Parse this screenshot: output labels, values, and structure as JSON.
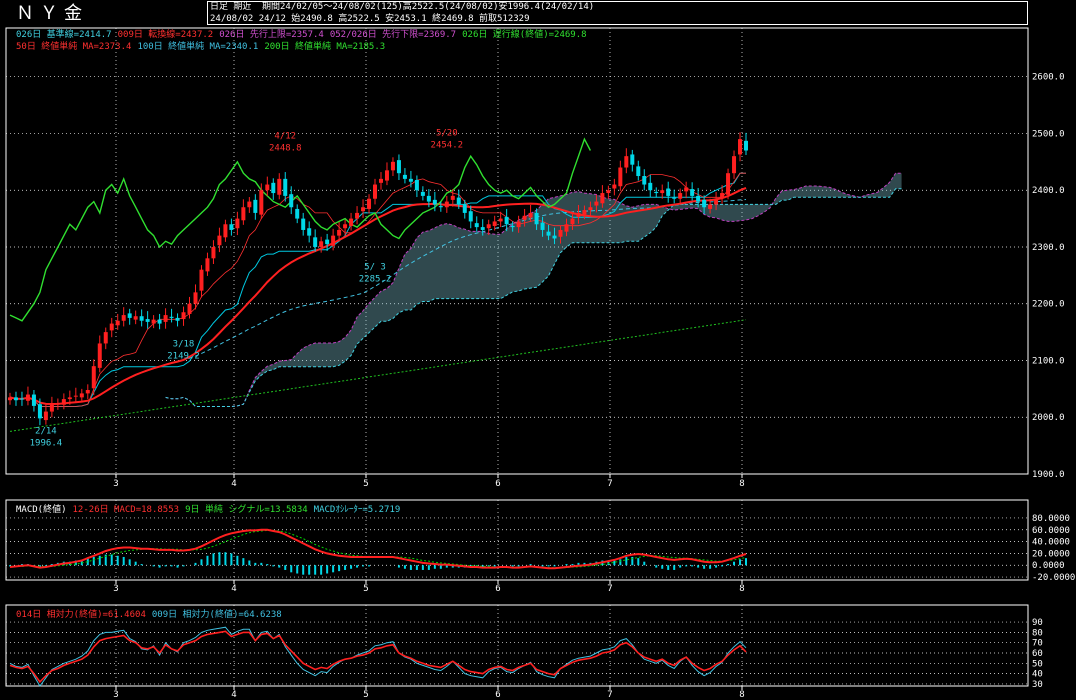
{
  "header": {
    "title": "ＮＹ金",
    "period_label": "日足 期近",
    "summary": "期間24/02/05～24/08/02(125)高2522.5(24/08/02)安1996.4(24/02/14)",
    "ohlc": "24/08/02 24/12 始2490.8 高2522.5 安2453.1 終2469.8 前取512329"
  },
  "colors": {
    "bg": "#000000",
    "frame": "#ffffff",
    "grid": "#ffffff",
    "candle_up": "#ff2020",
    "candle_down": "#00d8e8",
    "kijun": "#00c8e0",
    "tenkan": "#ff3030",
    "senkou_a": "#c040c0",
    "senkou_b": "#40d0e0",
    "chikou": "#30e030",
    "ma50": "#ff2020",
    "ma100": "#40c0e0",
    "ma200": "#20c020",
    "cloud": "#8ad0e0",
    "macd": "#ff2020",
    "signal": "#00d000",
    "osc": "#00d8e8",
    "rsi14": "#ff2020",
    "rsi9": "#40c0e0"
  },
  "legends": {
    "main_row1": [
      {
        "text": "026日 基準線=2414.7",
        "color": "#40d0e0"
      },
      {
        "text": "009日 転換線=2437.2",
        "color": "#ff3030"
      },
      {
        "text": "026日 先行上限=2357.4",
        "color": "#d050d0"
      },
      {
        "text": "052/026日 先行下限=2369.7",
        "color": "#d050d0"
      },
      {
        "text": "026日 遅行線(終値)=2469.8",
        "color": "#30e030"
      }
    ],
    "main_row2": [
      {
        "text": "50日 終値単純 MA=2373.4",
        "color": "#ff3030"
      },
      {
        "text": "100日 終値単純 MA=2340.1",
        "color": "#40c0e0"
      },
      {
        "text": "200日 終値単純 MA=2185.3",
        "color": "#30e030"
      }
    ],
    "macd": [
      {
        "text": "MACD(終値)",
        "color": "#ffffff"
      },
      {
        "text": "12-26日 MACD=18.8553",
        "color": "#ff3030"
      },
      {
        "text": "9日 単純 シグナル=13.5834",
        "color": "#30e030"
      },
      {
        "text": "MACDｵｼﾚｰﾀｰ=5.2719",
        "color": "#40d0e0"
      }
    ],
    "rsi": [
      {
        "text": "014日 相対力(終値)=61.4604",
        "color": "#ff3030"
      },
      {
        "text": "009日 相対力(終値)=64.6238",
        "color": "#40c0e0"
      }
    ]
  },
  "chart_data": [
    {
      "type": "candlestick",
      "title": "ＮＹ金",
      "x_ticks": [
        "3",
        "4",
        "5",
        "6",
        "7",
        "8"
      ],
      "y_ticks": [
        "2600.0",
        "2500.0",
        "2400.0",
        "2300.0",
        "2200.0",
        "2100.0",
        "2000.0",
        "1900.0"
      ],
      "ylim": [
        1900,
        2640
      ],
      "grid": true,
      "annotations": [
        {
          "label": "4/12",
          "value": "2448.8",
          "x": "2024-04-12",
          "y": 2448.8
        },
        {
          "label": "5/20",
          "value": "2454.2",
          "x": "2024-05-20",
          "y": 2454.2
        },
        {
          "label": "3/18",
          "value": "2149.2",
          "x": "2024-03-18",
          "y": 2149.2
        },
        {
          "label": "5/ 3",
          "value": "2285.2",
          "x": "2024-05-03",
          "y": 2285.2
        },
        {
          "label": "2/14",
          "value": "1996.4",
          "x": "2024-02-14",
          "y": 1996.4
        }
      ],
      "closes": [
        2035,
        2030,
        2032,
        2040,
        2020,
        1998,
        2010,
        2022,
        2025,
        2032,
        2035,
        2038,
        2042,
        2048,
        2090,
        2130,
        2150,
        2165,
        2170,
        2180,
        2175,
        2178,
        2170,
        2168,
        2172,
        2165,
        2180,
        2175,
        2170,
        2185,
        2200,
        2220,
        2260,
        2280,
        2300,
        2320,
        2340,
        2330,
        2350,
        2370,
        2380,
        2360,
        2400,
        2410,
        2395,
        2420,
        2390,
        2370,
        2350,
        2330,
        2320,
        2300,
        2310,
        2305,
        2320,
        2330,
        2340,
        2350,
        2360,
        2370,
        2385,
        2410,
        2420,
        2435,
        2450,
        2430,
        2420,
        2415,
        2400,
        2390,
        2380,
        2375,
        2370,
        2380,
        2390,
        2375,
        2360,
        2345,
        2335,
        2330,
        2340,
        2345,
        2350,
        2340,
        2335,
        2345,
        2355,
        2360,
        2340,
        2330,
        2320,
        2315,
        2330,
        2340,
        2350,
        2360,
        2365,
        2370,
        2380,
        2395,
        2400,
        2410,
        2440,
        2460,
        2445,
        2425,
        2410,
        2400,
        2395,
        2400,
        2390,
        2385,
        2395,
        2405,
        2390,
        2380,
        2370,
        2375,
        2385,
        2395,
        2430,
        2460,
        2490,
        2470
      ],
      "series": [
        {
          "name": "50日 終値単純 MA",
          "last": 2373.4
        },
        {
          "name": "100日 終値単純 MA",
          "last": 2340.1
        },
        {
          "name": "200日 終値単純 MA",
          "last": 2185.3
        },
        {
          "name": "026日 基準線",
          "last": 2414.7
        },
        {
          "name": "009日 転換線",
          "last": 2437.2
        },
        {
          "name": "026日 遅行線(終値)",
          "last": 2469.8
        }
      ]
    },
    {
      "type": "line",
      "title": "MACD(終値)",
      "y_ticks": [
        "80.0000",
        "60.0000",
        "40.0000",
        "20.0000",
        "0.0000",
        "-20.0000"
      ],
      "ylim": [
        -25,
        85
      ],
      "macd": [
        -3,
        -2,
        -1,
        0,
        -2,
        -4,
        -3,
        -1,
        1,
        3,
        4,
        6,
        8,
        12,
        16,
        20,
        24,
        27,
        29,
        30,
        30,
        29,
        28,
        28,
        27,
        26,
        26,
        26,
        25,
        25,
        26,
        28,
        32,
        37,
        42,
        47,
        51,
        54,
        56,
        58,
        59,
        59,
        60,
        60,
        58,
        56,
        52,
        47,
        42,
        37,
        32,
        27,
        23,
        20,
        18,
        16,
        15,
        14,
        14,
        14,
        14,
        14,
        14,
        14,
        14,
        12,
        10,
        8,
        6,
        4,
        3,
        2,
        1,
        1,
        0,
        -1,
        -2,
        -3,
        -3,
        -4,
        -4,
        -4,
        -3,
        -3,
        -4,
        -4,
        -3,
        -2,
        -3,
        -4,
        -5,
        -5,
        -4,
        -3,
        -2,
        -1,
        0,
        1,
        3,
        5,
        7,
        9,
        12,
        16,
        18,
        19,
        18,
        16,
        14,
        12,
        10,
        9,
        10,
        11,
        10,
        8,
        6,
        5,
        5,
        6,
        9,
        12,
        16,
        19
      ],
      "signal": [
        -2,
        -2,
        -2,
        -1,
        -1,
        -2,
        -2,
        -2,
        -1,
        0,
        1,
        2,
        4,
        6,
        9,
        12,
        15,
        18,
        21,
        23,
        25,
        26,
        27,
        28,
        28,
        28,
        27,
        27,
        27,
        26,
        26,
        26,
        27,
        29,
        32,
        36,
        40,
        44,
        48,
        52,
        55,
        57,
        58,
        59,
        59,
        58,
        56,
        53,
        49,
        45,
        40,
        35,
        31,
        27,
        24,
        21,
        19,
        17,
        16,
        15,
        15,
        14,
        14,
        14,
        14,
        14,
        13,
        12,
        10,
        8,
        7,
        5,
        4,
        3,
        2,
        1,
        0,
        -1,
        -1,
        -2,
        -2,
        -3,
        -3,
        -3,
        -3,
        -3,
        -3,
        -3,
        -3,
        -3,
        -4,
        -4,
        -4,
        -4,
        -3,
        -3,
        -2,
        -1,
        0,
        1,
        3,
        5,
        7,
        9,
        11,
        13,
        15,
        16,
        16,
        15,
        14,
        13,
        12,
        12,
        11,
        10,
        9,
        8,
        7,
        7,
        8,
        9,
        11,
        13
      ]
    },
    {
      "type": "line",
      "title": "相対力",
      "y_ticks": [
        "90",
        "80",
        "70",
        "60",
        "50",
        "40",
        "30"
      ],
      "ylim": [
        28,
        92
      ],
      "rsi14": [
        48,
        46,
        45,
        47,
        40,
        32,
        38,
        43,
        45,
        48,
        50,
        52,
        54,
        58,
        66,
        72,
        74,
        75,
        76,
        77,
        72,
        70,
        65,
        64,
        66,
        60,
        68,
        64,
        62,
        68,
        70,
        72,
        76,
        78,
        79,
        80,
        81,
        76,
        78,
        80,
        80,
        72,
        78,
        79,
        74,
        77,
        68,
        62,
        56,
        50,
        47,
        44,
        46,
        45,
        49,
        52,
        54,
        55,
        57,
        58,
        60,
        64,
        65,
        67,
        68,
        60,
        57,
        55,
        52,
        50,
        48,
        47,
        46,
        49,
        52,
        48,
        44,
        42,
        41,
        40,
        44,
        46,
        47,
        44,
        43,
        46,
        48,
        50,
        44,
        42,
        40,
        39,
        45,
        48,
        51,
        53,
        54,
        55,
        57,
        60,
        61,
        63,
        68,
        70,
        66,
        60,
        56,
        54,
        52,
        54,
        50,
        48,
        53,
        56,
        50,
        46,
        43,
        45,
        49,
        52,
        58,
        63,
        67,
        61
      ],
      "rsi9": [
        50,
        47,
        46,
        49,
        38,
        28,
        36,
        44,
        47,
        50,
        52,
        54,
        57,
        62,
        72,
        78,
        80,
        80,
        81,
        82,
        74,
        71,
        64,
        63,
        67,
        58,
        70,
        64,
        61,
        70,
        72,
        75,
        80,
        82,
        83,
        84,
        85,
        78,
        81,
        83,
        83,
        72,
        80,
        81,
        74,
        78,
        66,
        58,
        50,
        44,
        41,
        38,
        42,
        41,
        47,
        51,
        54,
        55,
        58,
        60,
        62,
        67,
        68,
        70,
        71,
        60,
        56,
        54,
        50,
        48,
        46,
        44,
        43,
        47,
        52,
        46,
        40,
        38,
        37,
        36,
        42,
        45,
        46,
        42,
        41,
        45,
        48,
        51,
        42,
        39,
        37,
        36,
        45,
        49,
        53,
        55,
        56,
        57,
        60,
        63,
        64,
        66,
        72,
        74,
        68,
        60,
        54,
        52,
        50,
        53,
        48,
        45,
        52,
        56,
        48,
        42,
        38,
        41,
        47,
        51,
        60,
        66,
        71,
        65
      ]
    }
  ]
}
